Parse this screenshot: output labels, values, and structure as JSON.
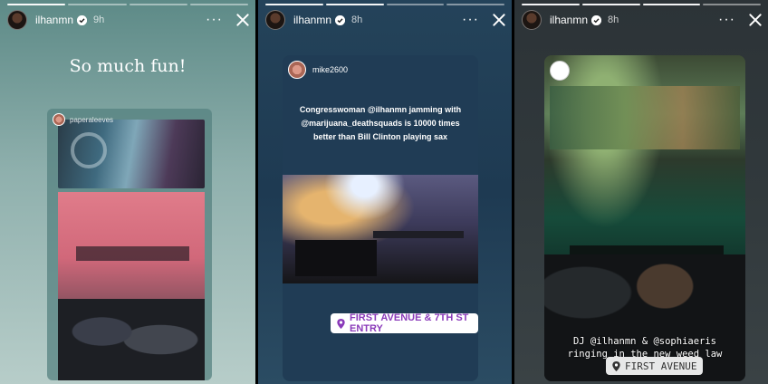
{
  "stories": [
    {
      "username": "ilhanmn",
      "time": "9h",
      "caption": "So much fun!",
      "repost": {
        "username": "paperaleeves"
      }
    },
    {
      "username": "ilhanmn",
      "time": "8h",
      "repost": {
        "username": "mike2600"
      },
      "tweet_text": "Congresswoman @ilhanmn jamming with @marijuana_deathsquads is 10000 times better than Bill Clinton playing sax",
      "location": "FIRST AVENUE & 7TH ST ENTRY"
    },
    {
      "username": "ilhanmn",
      "time": "8h",
      "overlay_line1": "DJ @ilhanmn & @sophiaeris",
      "overlay_line2": "ringing in the new weed law",
      "location": "FIRST AVENUE"
    }
  ],
  "icons": {
    "more": "more-icon",
    "close": "close-icon",
    "verified": "verified-badge-icon",
    "location": "location-pin-icon"
  },
  "colors": {
    "location_text": "#8a3ab9",
    "verified": "#3897f0"
  }
}
